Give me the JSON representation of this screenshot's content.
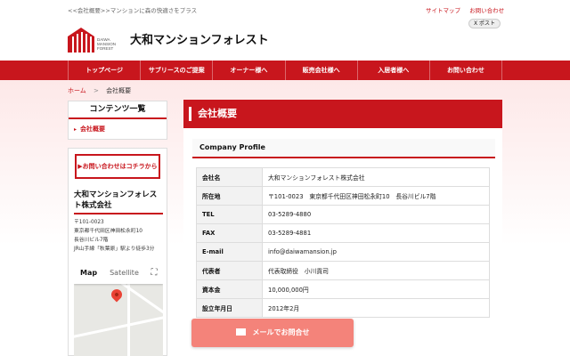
{
  "header": {
    "tagline": "<<会社概要>>マンションに森の快適さをプラス",
    "top_links": [
      "サイトマップ",
      "お問い合わせ"
    ],
    "x_post": "X ポスト",
    "logo_sub": "DAIWA\nMANSION\nFOREST",
    "site_name": "大和マンションフォレスト"
  },
  "nav": {
    "items": [
      "トップページ",
      "サブリースのご提案",
      "オーナー様へ",
      "販売会社様へ",
      "入居者様へ",
      "お問い合わせ"
    ]
  },
  "breadcrumb": {
    "home": "ホーム",
    "separator": ">",
    "current": "会社概要"
  },
  "sidebar": {
    "title": "コンテンツ一覧",
    "items": [
      "会社概要"
    ],
    "contact_button": "▶お問い合わせはコチラから",
    "company_name": "大和マンションフォレスト株式会社",
    "address_lines": [
      "〒101-0023",
      "東京都千代田区神田松永町10",
      "長谷川ビル7階",
      "JR山手線「秋葉原」駅より徒歩3分"
    ],
    "map_tabs": [
      "Map",
      "Satellite"
    ]
  },
  "main": {
    "title": "会社概要",
    "section_heading": "Company Profile",
    "rows": [
      {
        "label": "会社名",
        "value": "大和マンションフォレスト株式会社"
      },
      {
        "label": "所在地",
        "value": "〒101-0023　東京都千代田区神田松永町10　長谷川ビル7階"
      },
      {
        "label": "TEL",
        "value": "03-5289-4880"
      },
      {
        "label": "FAX",
        "value": "03-5289-4881"
      },
      {
        "label": "E-mail",
        "value": "info@daiwamansion.jp"
      },
      {
        "label": "代表者",
        "value": "代表取締役　小川貢司"
      },
      {
        "label": "資本金",
        "value": "10,000,000円"
      },
      {
        "label": "設立年月日",
        "value": "2012年2月"
      }
    ]
  },
  "float_button": {
    "label": "メールでお問合せ"
  },
  "colors": {
    "accent": "#c8161d",
    "button": "#f4837a"
  }
}
